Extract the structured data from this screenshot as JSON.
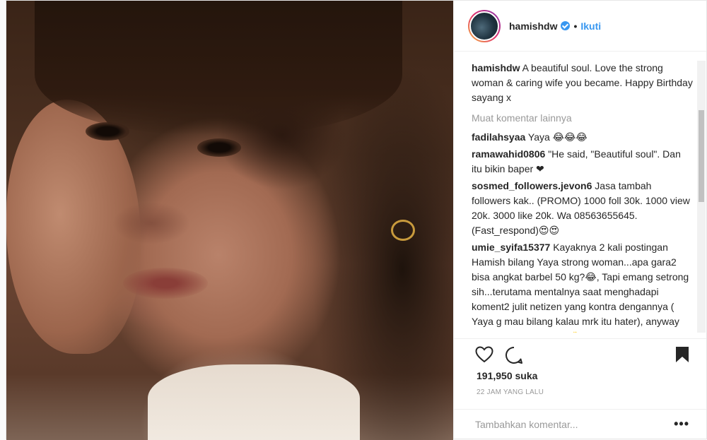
{
  "post": {
    "author": "hamishdw",
    "follow_label": "Ikuti",
    "dot": "•",
    "caption": {
      "user": "hamishdw",
      "text": "A beautiful soul. Love the strong woman & caring wife you became. Happy Birthday sayang x"
    },
    "load_more_label": "Muat komentar lainnya",
    "comments": [
      {
        "user": "fadilahsyaa",
        "text": "Yaya 😂😂😂"
      },
      {
        "user": "ramawahid0806",
        "text": "\"He said, \"Beautiful soul\". Dan itu bikin baper ❤"
      },
      {
        "user": "sosmed_followers.jevon6",
        "text": "Jasa tambah followers kak.. (PROMO) 1000 foll 30k. 1000 view 20k. 3000 like 20k. Wa 08563655645. (Fast_respond)😍😍"
      },
      {
        "user": "umie_syifa15377",
        "text": "Kayaknya 2 kali postingan Hamish bilang Yaya strong woman...apa gara2 bisa angkat barbel 50 kg?😂, Tapi emang setrong sih...terutama mentalnya saat menghadapi koment2 julit netizen yang kontra dengannya ( Yaya g mau bilang kalau mrk itu hater), anyway happy birthday ya teh 🎂 semoga sehat selalu"
      }
    ],
    "likes": "191,950 suka",
    "time": "22 JAM YANG LALU",
    "add_comment_placeholder": "Tambahkan komentar...",
    "more_options": "•••"
  },
  "icons": {
    "like": "heart-icon",
    "comment": "comment-icon",
    "save": "bookmark-icon",
    "verified": "verified-badge-icon"
  },
  "colors": {
    "link": "#3897f0",
    "muted": "#999999",
    "text": "#262626"
  }
}
